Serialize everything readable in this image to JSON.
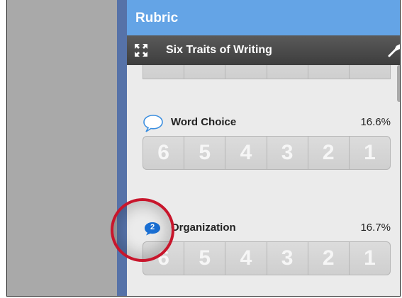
{
  "panel": {
    "title": "Rubric",
    "toolbar_title": "Six Traits of Writing"
  },
  "criteria": [
    {
      "name": "Word Choice",
      "weight": "16.6%",
      "comment_count": "",
      "scores": [
        "6",
        "5",
        "4",
        "3",
        "2",
        "1"
      ]
    },
    {
      "name": "Organization",
      "weight": "16.7%",
      "comment_count": "2",
      "scores": [
        "6",
        "5",
        "4",
        "3",
        "2",
        "1"
      ]
    }
  ],
  "colors": {
    "header": "#64a4e6",
    "toolbar": "#4a4a4a",
    "highlight": "#c8162c",
    "comment_badge": "#1a6fd3"
  },
  "icons": [
    "expand-icon",
    "wrench-icon",
    "comment-icon",
    "comment-count-badge"
  ]
}
